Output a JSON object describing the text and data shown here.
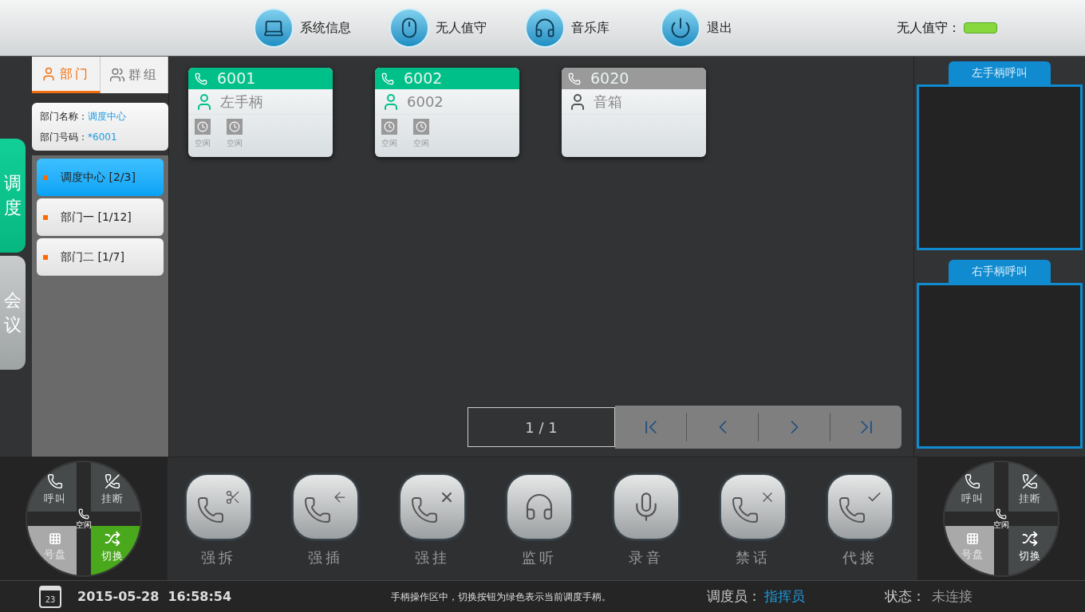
{
  "top_nav": [
    {
      "kind": "system",
      "label": "系统信息"
    },
    {
      "kind": "unattended",
      "label": "无人值守"
    },
    {
      "kind": "music",
      "label": "音乐库"
    },
    {
      "kind": "exit",
      "label": "退出"
    }
  ],
  "unattended": {
    "label": "无人值守：",
    "on": true
  },
  "side_tabs": [
    {
      "label": "调度",
      "selected": true
    },
    {
      "label": "会议",
      "selected": false
    }
  ],
  "dept_tabs": [
    {
      "kind": "dept",
      "label": "部门",
      "selected": true
    },
    {
      "kind": "group",
      "label": "群组",
      "selected": false
    }
  ],
  "dept_info": [
    {
      "label": "部门名称：",
      "value": "调度中心"
    },
    {
      "label": "部门号码：",
      "value": "*6001"
    }
  ],
  "departments": [
    {
      "label": "调度中心 [2/3]",
      "selected": true
    },
    {
      "label": "部门一 [1/12]",
      "selected": false
    },
    {
      "label": "部门二 [1/7]",
      "selected": false
    }
  ],
  "extensions": [
    {
      "number": "6001",
      "name": "左手柄",
      "color": "#00c08a",
      "lines": [
        "空闲",
        "空闲"
      ]
    },
    {
      "number": "6002",
      "name": "6002",
      "color": "#00c08a",
      "lines": [
        "空闲",
        "空闲"
      ]
    },
    {
      "number": "6020",
      "name": "音箱",
      "color": "#9a9a9a"
    }
  ],
  "pagination": {
    "page": "1 / 1"
  },
  "call_panels": [
    {
      "title": "左手柄呼叫"
    },
    {
      "title": "右手柄呼叫"
    }
  ],
  "handsets": [
    {
      "call": "呼叫",
      "hangup": "挂断",
      "dial": "号盘",
      "switch": "切换",
      "status": "空闲",
      "active": true
    },
    {
      "call": "呼叫",
      "hangup": "挂断",
      "dial": "号盘",
      "switch": "切换",
      "status": "空闲",
      "active": false
    }
  ],
  "actions": [
    {
      "kind": "split",
      "label": "强拆"
    },
    {
      "kind": "insert",
      "label": "强插"
    },
    {
      "kind": "hangup",
      "label": "强挂"
    },
    {
      "kind": "monitor",
      "label": "监听"
    },
    {
      "kind": "record",
      "label": "录音"
    },
    {
      "kind": "mute",
      "label": "禁话"
    },
    {
      "kind": "pickup",
      "label": "代接"
    }
  ],
  "status_bar": {
    "date": "23",
    "datetime": "2015-05-28  16:58:54",
    "hint": "手柄操作区中，切换按钮为绿色表示当前调度手柄。",
    "operator_label": "调度员：",
    "operator": "指挥员",
    "state_label": "状态：",
    "state": "未连接"
  }
}
